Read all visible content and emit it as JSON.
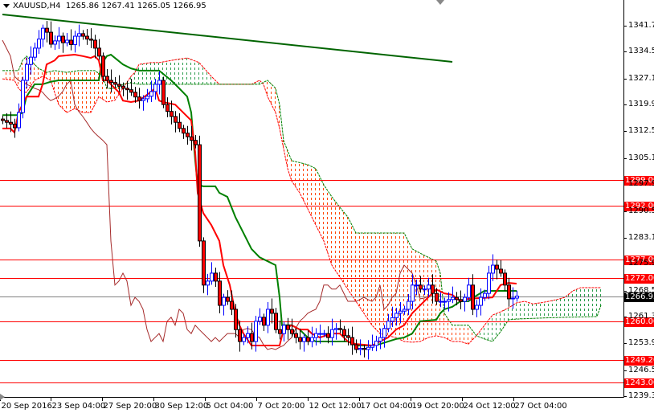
{
  "header": {
    "symbol": "XAUUSD,H4",
    "ohlc": "1265.86 1267.41 1265.05 1266.95"
  },
  "colors": {
    "bull": "#0000ff",
    "bear": "#ff0000",
    "tenkan": "#ff0000",
    "kijun": "#008000",
    "chikou": "#a52a2a",
    "trend": "#006400",
    "level": "#ff0000",
    "current": "#808080",
    "cloud_bull": "#2e9e4f",
    "cloud_bear": "#ff4500"
  },
  "chart_data": {
    "type": "candlestick",
    "title": "XAUUSD,H4",
    "ylim": [
      1239.3,
      1341.7
    ],
    "y_ticks": [
      "1341.70",
      "1334.50",
      "1327.10",
      "1319.90",
      "1312.50",
      "1305.10",
      "1297.90",
      "1290.50",
      "1283.10",
      "1275.90",
      "1268.50",
      "1261.30",
      "1253.90",
      "1246.50",
      "1239.30"
    ],
    "x_ticks": [
      {
        "label": "20 Sep 2016",
        "index": 0
      },
      {
        "label": "23 Sep 04:00",
        "index": 12.6
      },
      {
        "label": "27 Sep 20:00",
        "index": 25.4
      },
      {
        "label": "30 Sep 12:00",
        "index": 38.2
      },
      {
        "label": "5 Oct 04:00",
        "index": 51
      },
      {
        "label": "7 Oct 20:00",
        "index": 63.8
      },
      {
        "label": "12 Oct 12:00",
        "index": 76.6
      },
      {
        "label": "17 Oct 04:00",
        "index": 89.4
      },
      {
        "label": "19 Oct 20:00",
        "index": 102.2
      },
      {
        "label": "24 Oct 12:00",
        "index": 115
      },
      {
        "label": "27 Oct 04:00",
        "index": 127.8
      }
    ],
    "closes": [
      1315.5,
      1315.0,
      1314.5,
      1313.5,
      1317.7,
      1326.6,
      1331.0,
      1333.0,
      1335.5,
      1338.0,
      1341.0,
      1339.9,
      1336.6,
      1337.5,
      1338.8,
      1337.0,
      1337.7,
      1336.5,
      1338.8,
      1339.5,
      1338.8,
      1338.0,
      1337.7,
      1335.5,
      1333.3,
      1327.7,
      1326.6,
      1326.0,
      1325.5,
      1325.0,
      1324.4,
      1324.0,
      1323.3,
      1322.0,
      1321.0,
      1321.5,
      1322.2,
      1323.5,
      1325.5,
      1326.6,
      1319.9,
      1318.0,
      1316.6,
      1315.0,
      1313.3,
      1312.0,
      1311.0,
      1310.0,
      1308.8,
      1282.2,
      1270.0,
      1271.1,
      1273.3,
      1271.1,
      1264.4,
      1266.6,
      1265.5,
      1263.3,
      1257.7,
      1254.4,
      1255.5,
      1256.6,
      1254.4,
      1260.0,
      1261.1,
      1258.9,
      1263.3,
      1262.2,
      1257.7,
      1256.6,
      1258.9,
      1257.7,
      1256.6,
      1255.5,
      1254.4,
      1255.5,
      1254.4,
      1255.5,
      1256.6,
      1256.6,
      1256.6,
      1255.5,
      1257.7,
      1258.0,
      1257.7,
      1256.0,
      1255.5,
      1253.5,
      1252.2,
      1252.5,
      1252.2,
      1252.8,
      1253.3,
      1254.5,
      1255.5,
      1258.0,
      1260.0,
      1261.0,
      1262.2,
      1262.8,
      1263.3,
      1265.5,
      1270.0,
      1270.0,
      1268.9,
      1268.9,
      1270.0,
      1267.7,
      1265.5,
      1265.5,
      1265.5,
      1266.0,
      1266.6,
      1266.0,
      1265.5,
      1266.6,
      1270.0,
      1263.3,
      1264.4,
      1266.6,
      1267.7,
      1273.3,
      1275.5,
      1274.4,
      1273.3,
      1270.0,
      1266.2,
      1266.4,
      1266.95
    ],
    "chikou_shift": 22,
    "tenkan": [
      [
        0,
        1313.3
      ],
      [
        2,
        1313.3
      ],
      [
        3,
        1312.2
      ],
      [
        4,
        1317.7
      ],
      [
        6,
        1322.1
      ],
      [
        9,
        1322.1
      ],
      [
        10,
        1325.5
      ],
      [
        11,
        1331.0
      ],
      [
        13,
        1332.1
      ],
      [
        14,
        1333.3
      ],
      [
        18,
        1333.7
      ],
      [
        20,
        1333.3
      ],
      [
        22,
        1332.8
      ],
      [
        23,
        1333.3
      ],
      [
        24,
        1332.1
      ],
      [
        25,
        1326.6
      ],
      [
        26,
        1326.6
      ],
      [
        28,
        1324.4
      ],
      [
        29,
        1323.3
      ],
      [
        30,
        1321.0
      ],
      [
        32,
        1320.6
      ],
      [
        34,
        1321.0
      ],
      [
        36,
        1322.6
      ],
      [
        38,
        1324.4
      ],
      [
        39,
        1321.0
      ],
      [
        40,
        1320.6
      ],
      [
        43,
        1319.9
      ],
      [
        45,
        1317.7
      ],
      [
        47,
        1315.5
      ],
      [
        48,
        1306.6
      ],
      [
        48.6,
        1295.5
      ],
      [
        50,
        1289.9
      ],
      [
        52,
        1286.6
      ],
      [
        54,
        1282.2
      ],
      [
        55,
        1275.5
      ],
      [
        56.6,
        1270.0
      ],
      [
        58,
        1262.2
      ],
      [
        59,
        1258.9
      ],
      [
        60,
        1256.6
      ],
      [
        62,
        1253.3
      ],
      [
        69,
        1253.3
      ],
      [
        70,
        1257.7
      ],
      [
        72,
        1258.9
      ],
      [
        74,
        1257.7
      ],
      [
        76,
        1257.7
      ],
      [
        77,
        1256.6
      ],
      [
        79,
        1255.5
      ],
      [
        82,
        1256.6
      ],
      [
        84,
        1256.6
      ],
      [
        86,
        1254.4
      ],
      [
        88,
        1253.7
      ],
      [
        92,
        1253.3
      ],
      [
        94,
        1254.4
      ],
      [
        96,
        1255.5
      ],
      [
        98,
        1257.7
      ],
      [
        100,
        1258.9
      ],
      [
        102,
        1262.2
      ],
      [
        104,
        1264.4
      ],
      [
        106,
        1266.6
      ],
      [
        108,
        1268.8
      ],
      [
        110,
        1267.7
      ],
      [
        112,
        1267.3
      ],
      [
        114,
        1265.5
      ],
      [
        116,
        1266.2
      ],
      [
        122,
        1266.6
      ],
      [
        124,
        1270.0
      ],
      [
        126,
        1270.6
      ],
      [
        128,
        1270.4
      ]
    ],
    "kijun": [
      [
        0,
        1317.0
      ],
      [
        4,
        1317.0
      ],
      [
        5,
        1317.7
      ],
      [
        6,
        1322.1
      ],
      [
        8,
        1325.5
      ],
      [
        10,
        1325.5
      ],
      [
        12,
        1326.2
      ],
      [
        14,
        1326.6
      ],
      [
        24,
        1326.6
      ],
      [
        24.6,
        1331.0
      ],
      [
        26,
        1333.3
      ],
      [
        27,
        1333.7
      ],
      [
        28,
        1332.8
      ],
      [
        30,
        1331.0
      ],
      [
        32,
        1329.9
      ],
      [
        34,
        1329.3
      ],
      [
        39,
        1329.3
      ],
      [
        40,
        1328.4
      ],
      [
        42,
        1326.6
      ],
      [
        44,
        1324.4
      ],
      [
        46,
        1322.1
      ],
      [
        47,
        1317.7
      ],
      [
        48,
        1304.4
      ],
      [
        48.6,
        1297.7
      ],
      [
        50,
        1297.3
      ],
      [
        53,
        1297.3
      ],
      [
        54,
        1295.5
      ],
      [
        56,
        1294.4
      ],
      [
        58,
        1288.8
      ],
      [
        60,
        1284.4
      ],
      [
        62,
        1280.0
      ],
      [
        64,
        1277.7
      ],
      [
        66,
        1276.6
      ],
      [
        68,
        1275.5
      ],
      [
        69,
        1266.6
      ],
      [
        69.6,
        1258.9
      ],
      [
        72,
        1258.9
      ],
      [
        74,
        1257.7
      ],
      [
        76,
        1255.5
      ],
      [
        78,
        1254.4
      ],
      [
        86,
        1254.4
      ],
      [
        88,
        1253.3
      ],
      [
        92,
        1253.3
      ],
      [
        94,
        1253.7
      ],
      [
        96,
        1254.4
      ],
      [
        98,
        1255.1
      ],
      [
        100,
        1255.5
      ],
      [
        102,
        1256.6
      ],
      [
        104,
        1260.0
      ],
      [
        108,
        1260.4
      ],
      [
        109,
        1262.2
      ],
      [
        110,
        1263.3
      ],
      [
        112,
        1264.0
      ],
      [
        114,
        1265.5
      ],
      [
        116,
        1265.5
      ],
      [
        118,
        1267.1
      ],
      [
        120,
        1268.4
      ],
      [
        128,
        1268.4
      ]
    ],
    "senkou_a": [
      [
        0,
        1327.0
      ],
      [
        3,
        1326.6
      ],
      [
        4,
        1324.4
      ],
      [
        5,
        1323.3
      ],
      [
        6,
        1323.3
      ],
      [
        8,
        1326.6
      ],
      [
        10,
        1327.7
      ],
      [
        12,
        1326.6
      ],
      [
        14,
        1319.9
      ],
      [
        16,
        1317.7
      ],
      [
        18,
        1318.8
      ],
      [
        20,
        1317.7
      ],
      [
        22,
        1317.7
      ],
      [
        24,
        1322.1
      ],
      [
        26,
        1320.6
      ],
      [
        28,
        1321.1
      ],
      [
        30,
        1324.4
      ],
      [
        32,
        1327.7
      ],
      [
        33,
        1328.8
      ],
      [
        34,
        1331.0
      ],
      [
        37,
        1331.5
      ],
      [
        39,
        1331.5
      ],
      [
        42,
        1332.1
      ],
      [
        46,
        1332.8
      ],
      [
        49,
        1331.5
      ],
      [
        52,
        1327.7
      ],
      [
        54,
        1325.5
      ],
      [
        58,
        1325.5
      ],
      [
        62,
        1325.5
      ],
      [
        64,
        1326.6
      ],
      [
        65,
        1325.5
      ],
      [
        66,
        1322.1
      ],
      [
        68,
        1317.7
      ],
      [
        69,
        1313.3
      ],
      [
        70,
        1307.7
      ],
      [
        71,
        1302.2
      ],
      [
        72,
        1298.8
      ],
      [
        74,
        1295.5
      ],
      [
        76,
        1291.1
      ],
      [
        78,
        1286.6
      ],
      [
        80,
        1282.2
      ],
      [
        82,
        1275.5
      ],
      [
        84,
        1272.2
      ],
      [
        86,
        1268.8
      ],
      [
        88,
        1265.5
      ],
      [
        90,
        1262.2
      ],
      [
        92,
        1258.9
      ],
      [
        94,
        1256.6
      ],
      [
        96,
        1256.0
      ],
      [
        98,
        1255.5
      ],
      [
        100,
        1254.4
      ],
      [
        102,
        1254.2
      ],
      [
        104,
        1254.4
      ],
      [
        106,
        1255.5
      ],
      [
        108,
        1256.0
      ],
      [
        110,
        1255.5
      ],
      [
        112,
        1254.4
      ],
      [
        114,
        1254.4
      ],
      [
        116,
        1253.7
      ],
      [
        118,
        1256.0
      ],
      [
        120,
        1258.9
      ],
      [
        122,
        1261.7
      ],
      [
        124,
        1262.6
      ],
      [
        126,
        1263.7
      ],
      [
        128,
        1265.1
      ],
      [
        130,
        1265.5
      ],
      [
        132,
        1264.8
      ],
      [
        134,
        1265.1
      ],
      [
        136,
        1265.5
      ],
      [
        138,
        1266.0
      ],
      [
        140,
        1266.6
      ],
      [
        142,
        1268.4
      ],
      [
        144,
        1269.3
      ],
      [
        149,
        1269.3
      ]
    ],
    "senkou_b": [
      [
        0,
        1329.3
      ],
      [
        4,
        1329.3
      ],
      [
        5,
        1332.1
      ],
      [
        6,
        1333.3
      ],
      [
        9,
        1329.9
      ],
      [
        11,
        1328.8
      ],
      [
        13,
        1329.3
      ],
      [
        16,
        1328.8
      ],
      [
        19,
        1329.3
      ],
      [
        23,
        1329.3
      ],
      [
        25,
        1327.7
      ],
      [
        26,
        1324.4
      ],
      [
        28,
        1324.4
      ],
      [
        30,
        1325.5
      ],
      [
        32,
        1325.9
      ],
      [
        34,
        1325.5
      ],
      [
        64,
        1325.5
      ],
      [
        66,
        1326.6
      ],
      [
        68,
        1324.4
      ],
      [
        69,
        1319.9
      ],
      [
        70,
        1309.9
      ],
      [
        72,
        1304.4
      ],
      [
        76,
        1303.3
      ],
      [
        78,
        1302.2
      ],
      [
        80,
        1297.7
      ],
      [
        82,
        1294.4
      ],
      [
        84,
        1291.5
      ],
      [
        86,
        1288.8
      ],
      [
        88,
        1284.4
      ],
      [
        100,
        1284.4
      ],
      [
        102,
        1280.0
      ],
      [
        104,
        1278.8
      ],
      [
        106,
        1277.7
      ],
      [
        108,
        1276.6
      ],
      [
        109,
        1273.3
      ],
      [
        109.6,
        1266.6
      ],
      [
        110,
        1262.2
      ],
      [
        112,
        1258.9
      ],
      [
        116,
        1258.9
      ],
      [
        118,
        1256.0
      ],
      [
        120,
        1255.1
      ],
      [
        122,
        1254.4
      ],
      [
        124,
        1257.1
      ],
      [
        126,
        1260.4
      ],
      [
        128,
        1260.6
      ],
      [
        132,
        1260.8
      ],
      [
        140,
        1261.1
      ],
      [
        148,
        1261.3
      ],
      [
        149,
        1264.4
      ]
    ],
    "trendline": [
      [
        0,
        1344.8
      ],
      [
        112,
        1331.7
      ]
    ],
    "levels": [
      {
        "label": "1299.00",
        "price": 1299.0
      },
      {
        "label": "1292.00",
        "price": 1292.0
      },
      {
        "label": "1277.00",
        "price": 1277.0
      },
      {
        "label": "1272.00",
        "price": 1272.0
      },
      {
        "label": "1260.00",
        "price": 1260.0
      },
      {
        "label": "1249.20",
        "price": 1249.2
      },
      {
        "label": "1243.00",
        "price": 1243.0
      }
    ],
    "current": {
      "label": "1266.95",
      "price": 1266.95
    }
  }
}
